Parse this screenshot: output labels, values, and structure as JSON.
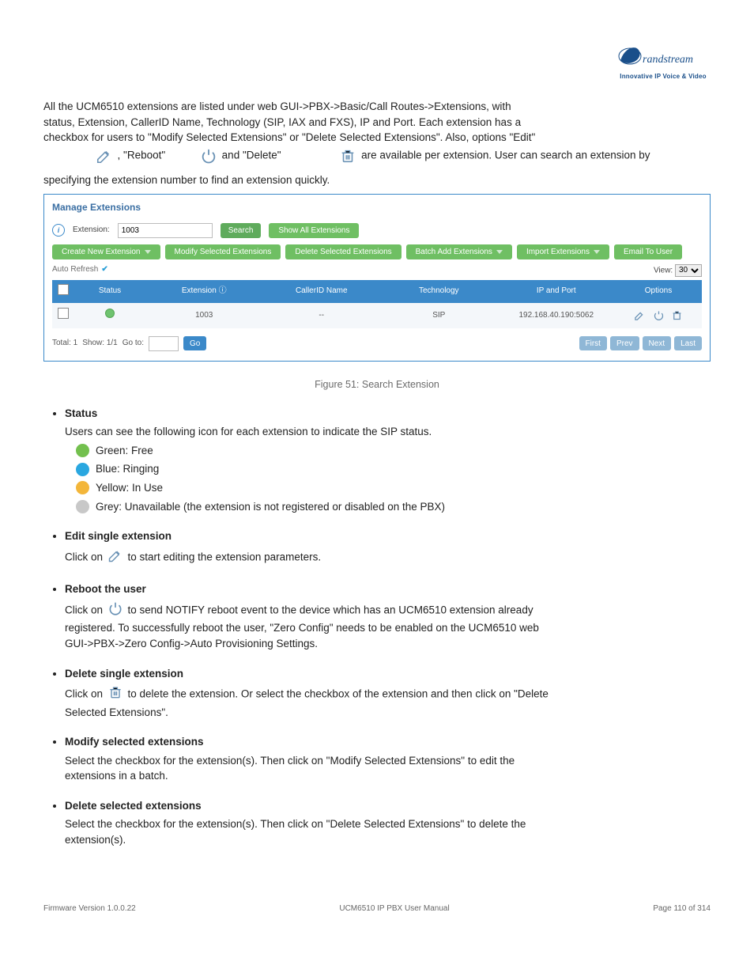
{
  "intro": {
    "line1": "All the UCM6510 extensions are listed under web GUI->PBX->Basic/Call Routes->Extensions, with",
    "line2_a": "status, Extension, CallerID Name, Technology (SIP, IAX and FXS), IP and Port. Each extension has a",
    "line2_b": "checkbox for users to \"Modify Selected Extensions\" or \"Delete Selected Extensions\". Also, options \"Edit\"",
    "line3_a": ", \"Reboot\" ",
    "line3_b": " and \"Delete\" ",
    "line3_c": " are available per extension. User can search an extension by",
    "line4": "specifying the extension number to find an extension quickly."
  },
  "shot": {
    "title": "Manage Extensions",
    "ext_label": "Extension:",
    "ext_value": "1003",
    "search_btn": "Search",
    "show_all_btn": "Show All Extensions",
    "btns": {
      "create": "Create New Extension",
      "modify": "Modify Selected Extensions",
      "delete": "Delete Selected Extensions",
      "batch": "Batch Add Extensions",
      "import": "Import Extensions",
      "email": "Email To User"
    },
    "auto_refresh": "Auto Refresh",
    "view_label": "View:",
    "view_value": "30",
    "headers": {
      "status": "Status",
      "ext": "Extension ⓘ",
      "cid": "CallerID Name",
      "tech": "Technology",
      "ip": "IP and Port",
      "opt": "Options"
    },
    "row": {
      "ext": "1003",
      "cid": "--",
      "tech": "SIP",
      "ip": "192.168.40.190:5062"
    },
    "pager": {
      "total": "Total: 1",
      "show": "Show: 1/1",
      "goto": "Go to:",
      "go": "Go",
      "first": "First",
      "prev": "Prev",
      "next": "Next",
      "last": "Last"
    }
  },
  "caption": "Figure 51: Search Extension",
  "sections": {
    "status": {
      "title": "Status",
      "desc": "Users can see the following icon for each extension to indicate the SIP status.",
      "items": [
        {
          "color": "green",
          "label": "Green: Free"
        },
        {
          "color": "blue",
          "label": "Blue: Ringing"
        },
        {
          "color": "yellow",
          "label": "Yellow: In Use"
        },
        {
          "color": "grey",
          "label": "Grey: Unavailable (the extension is not registered or disabled on the PBX)"
        }
      ]
    },
    "edit": {
      "title": "Edit single extension",
      "a": "Click on ",
      "b": " to start editing the extension parameters."
    },
    "reboot": {
      "title": "Reboot the user",
      "a": "Click on ",
      "b": " to send NOTIFY reboot event to the device which has an UCM6510 extension already",
      "c": "registered. To successfully reboot the user, \"Zero Config\" needs to be enabled on the UCM6510 web",
      "d": "GUI->PBX->Zero Config->Auto Provisioning Settings."
    },
    "delete_single": {
      "title": "Delete single extension",
      "a": "Click on ",
      "b": " to delete the extension. Or select the checkbox of the extension and then click on \"Delete",
      "c": "Selected Extensions\"."
    },
    "modify_sel": {
      "title": "Modify selected extensions",
      "a": "Select the checkbox for the extension(s). Then click on \"Modify Selected Extensions\" to edit the",
      "b": "extensions in a batch."
    },
    "delete_sel": {
      "title": "Delete selected extensions",
      "a": "Select the checkbox for the extension(s). Then click on \"Delete Selected Extensions\" to delete the",
      "b": "extension(s)."
    }
  },
  "footer": {
    "left_a": "Firmware Version 1.0.0.22",
    "left_b": "UCM6510 IP PBX User Manual",
    "right_a": "Page 110 of 314",
    "right_b": ""
  }
}
